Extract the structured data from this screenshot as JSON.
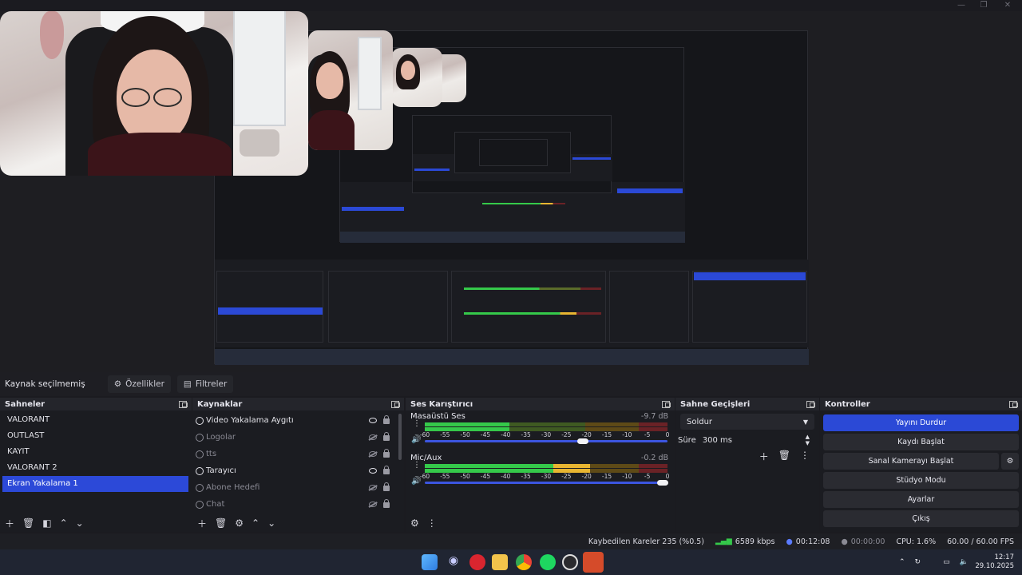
{
  "window": {
    "minimize": "—",
    "maximize": "❐",
    "close": "✕"
  },
  "toolbar": {
    "no_source": "Kaynak seçilmemiş",
    "properties": "Özellikler",
    "filters": "Filtreler"
  },
  "scenes": {
    "title": "Sahneler",
    "items": [
      "VALORANT",
      "OUTLAST",
      "KAYIT",
      "VALORANT 2",
      "Ekran Yakalama 1"
    ],
    "active_index": 4
  },
  "sources": {
    "title": "Kaynaklar",
    "items": [
      {
        "label": "Video Yakalama Aygıtı",
        "visible": true
      },
      {
        "label": "Logolar",
        "visible": false
      },
      {
        "label": "tts",
        "visible": false
      },
      {
        "label": "Tarayıcı",
        "visible": true
      },
      {
        "label": "Abone Hedefi",
        "visible": false
      },
      {
        "label": "Chat",
        "visible": false
      }
    ]
  },
  "mixer": {
    "title": "Ses Karıştırıcı",
    "channels": [
      {
        "name": "Masaüstü Ses",
        "db": "-9.7 dB",
        "level_green": 0.35,
        "level_yellow": 0.0,
        "volume": 0.65
      },
      {
        "name": "Mic/Aux",
        "db": "-0.2 dB",
        "level_green": 0.53,
        "level_yellow": 0.15,
        "volume": 0.98
      }
    ],
    "scale": [
      "-60",
      "-55",
      "-50",
      "-45",
      "-40",
      "-35",
      "-30",
      "-25",
      "-20",
      "-15",
      "-10",
      "-5",
      "0"
    ]
  },
  "transitions": {
    "title": "Sahne Geçişleri",
    "selected": "Soldur",
    "duration_label": "Süre",
    "duration_value": "300 ms"
  },
  "controls": {
    "title": "Kontroller",
    "stop_stream": "Yayını Durdur",
    "start_record": "Kaydı Başlat",
    "virtual_cam": "Sanal Kamerayı Başlat",
    "studio_mode": "Stüdyo Modu",
    "settings": "Ayarlar",
    "exit": "Çıkış"
  },
  "status": {
    "dropped_frames": "Kaybedilen Kareler 235 (%0.5)",
    "bitrate": "6589 kbps",
    "stream_time": "00:12:08",
    "record_time": "00:00:00",
    "cpu": "CPU: 1.6%",
    "fps": "60.00 / 60.00 FPS"
  },
  "clock": {
    "time": "12:17",
    "date": "29.10.2025"
  },
  "colors": {
    "accent": "#2b49d6",
    "meter_green": "#35c94a",
    "meter_yellow": "#e8b531",
    "meter_red": "#c9303a"
  }
}
